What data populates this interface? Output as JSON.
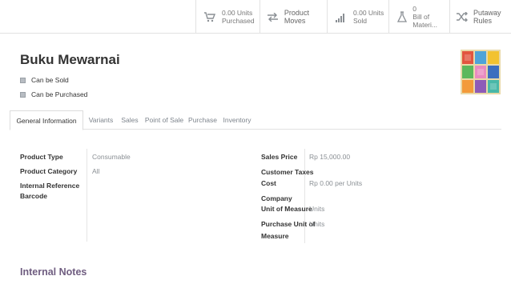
{
  "smart_buttons": [
    {
      "id": "purchased",
      "line1": "0.00 Units",
      "line2": "Purchased",
      "icon": "cart-icon"
    },
    {
      "id": "moves",
      "line1": "Product Moves",
      "line2": "",
      "icon": "exchange-icon"
    },
    {
      "id": "sold",
      "line1": "0.00 Units",
      "line2": "Sold",
      "icon": "bar-chart-icon"
    },
    {
      "id": "bom",
      "line1": "0",
      "line2": "Bill of Materi...",
      "icon": "flask-icon"
    },
    {
      "id": "putaway",
      "line1": "Putaway Rules",
      "line2": "",
      "icon": "random-icon"
    }
  ],
  "product": {
    "name": "Buku Mewarnai",
    "can_be_sold": "Can be Sold",
    "can_be_purchased": "Can be Purchased"
  },
  "tabs": [
    "General Information",
    "Variants",
    "Sales",
    "Point of Sale",
    "Purchase",
    "Inventory"
  ],
  "left_fields": [
    {
      "label": "Product Type",
      "value": "Consumable"
    },
    {
      "label": "Product Category",
      "value": "All"
    },
    {
      "label": "Internal Reference",
      "value": ""
    },
    {
      "label": "Barcode",
      "value": ""
    }
  ],
  "right_fields": [
    {
      "label": "Sales Price",
      "value": "Rp 15,000.00"
    },
    {
      "label": "Customer Taxes",
      "value": ""
    },
    {
      "label": "Cost",
      "value": "Rp 0.00 per Units"
    },
    {
      "label": "Company",
      "value": ""
    },
    {
      "label": "Unit of Measure",
      "value": "Units"
    },
    {
      "label": "Purchase Unit of",
      "label2": "Measure",
      "value": "Units"
    }
  ],
  "internal_notes": "Internal Notes",
  "colors": {
    "accent": "#6f5d80",
    "muted": "#8a8f94"
  }
}
